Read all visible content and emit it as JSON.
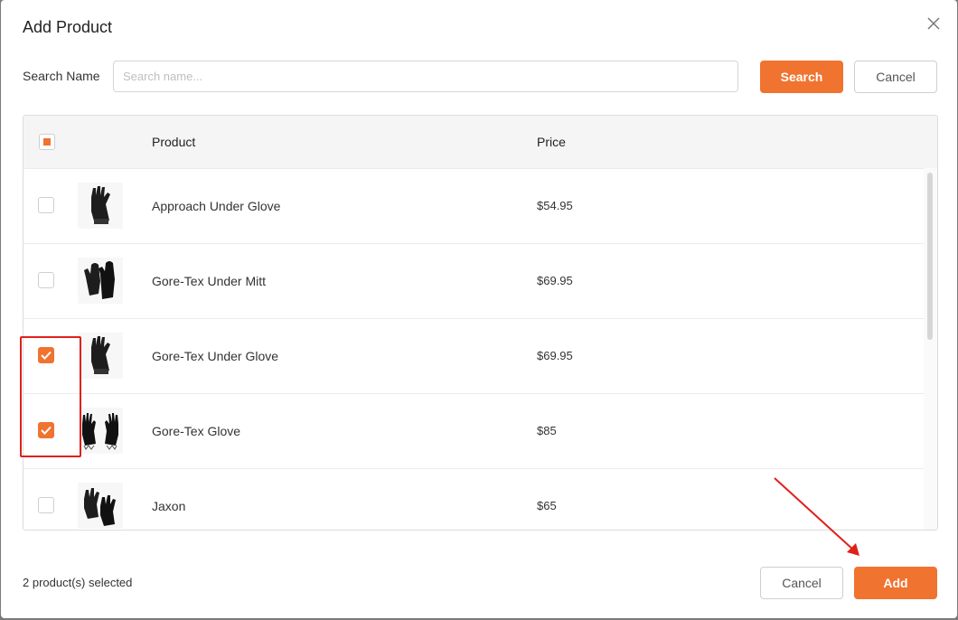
{
  "dialog": {
    "title": "Add Product"
  },
  "search": {
    "label": "Search Name",
    "placeholder": "Search name...",
    "value": "",
    "search_button": "Search",
    "cancel_button": "Cancel"
  },
  "table": {
    "headers": {
      "product": "Product",
      "price": "Price"
    },
    "rows": [
      {
        "name": "Approach Under Glove",
        "price": "$54.95",
        "checked": false,
        "image": "single-glove-icon"
      },
      {
        "name": "Gore-Tex Under Mitt",
        "price": "$69.95",
        "checked": false,
        "image": "mitt-icon"
      },
      {
        "name": "Gore-Tex Under Glove",
        "price": "$69.95",
        "checked": true,
        "image": "single-glove-icon"
      },
      {
        "name": "Gore-Tex Glove",
        "price": "$85",
        "checked": true,
        "image": "glove-pair-icon"
      },
      {
        "name": "Jaxon",
        "price": "$65",
        "checked": false,
        "image": "glove-pair-icon"
      }
    ]
  },
  "footer": {
    "selected_text": "2 product(s) selected",
    "cancel_button": "Cancel",
    "add_button": "Add"
  },
  "colors": {
    "accent": "#f07330",
    "annotation": "#e0201b"
  }
}
